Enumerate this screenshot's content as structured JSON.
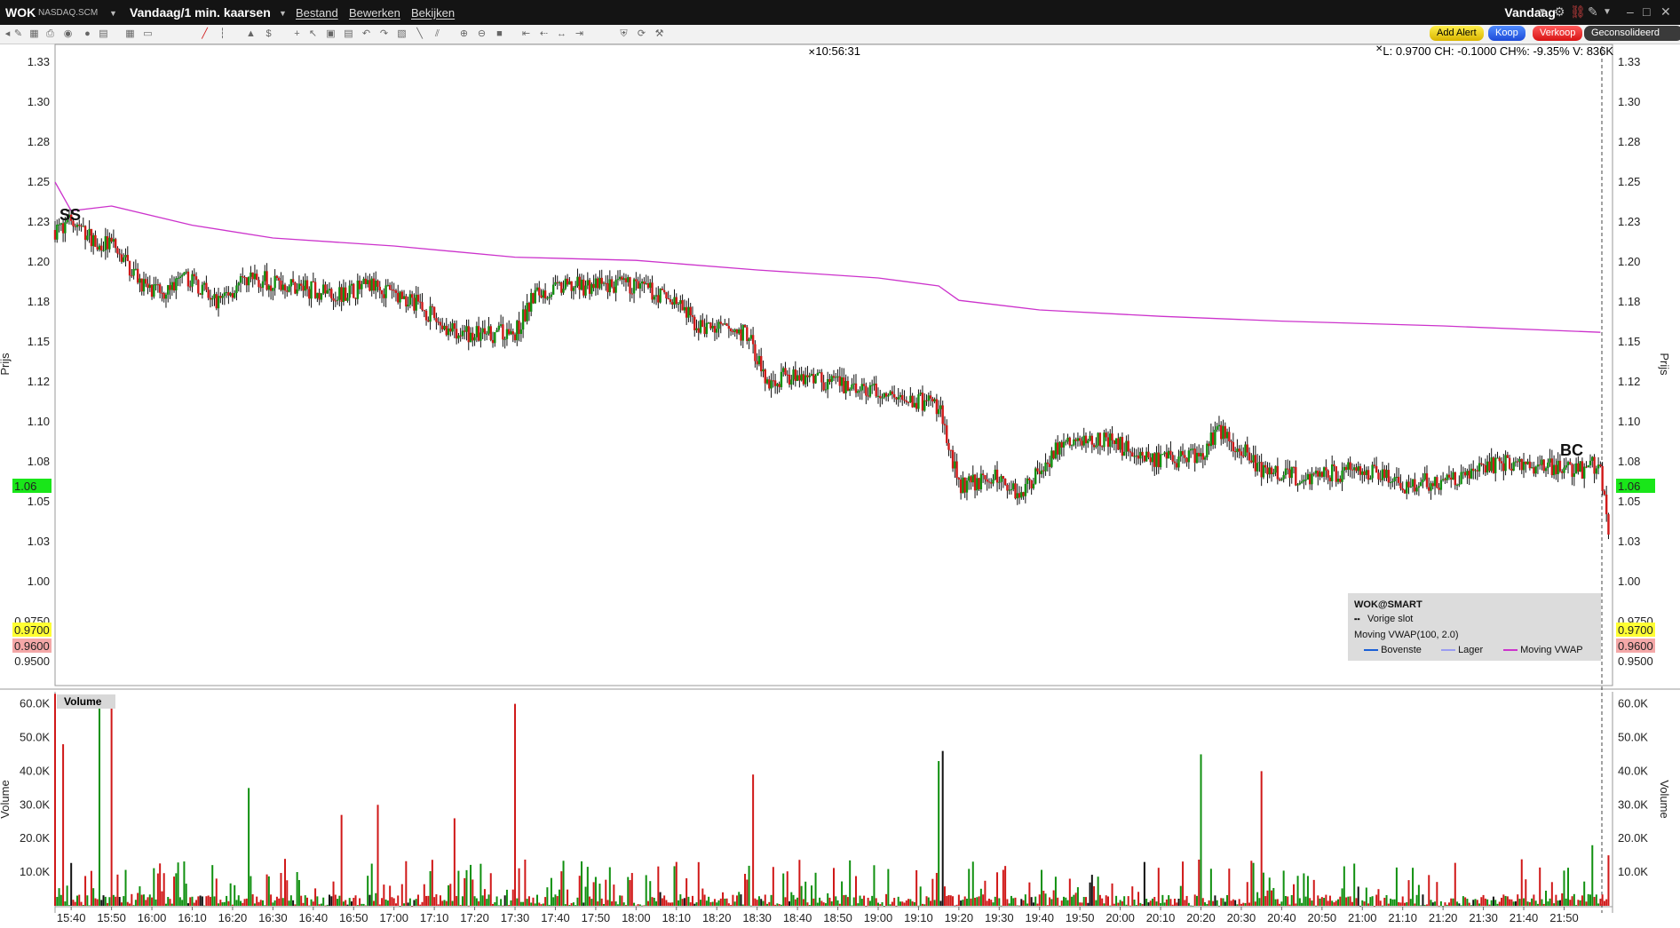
{
  "window": {
    "symbol": "WOK",
    "exchange": "NASDAQ.SCM",
    "period": "Vandaag/1 min. kaarsen",
    "menus": [
      "Bestand",
      "Bewerken",
      "Bekijken"
    ],
    "right_title": "Vandaag"
  },
  "toolbar": {
    "add_alert": "Add Alert",
    "buy": "Koop",
    "sell": "Verkoop",
    "consolidated": "Geconsolideerd"
  },
  "readout": {
    "crosshair_time": "10:56:31",
    "ohlc": "L: 0.9700 CH: -0.1000 CH%: -9.35% V: 836K"
  },
  "legend": {
    "title": "WOK@SMART",
    "prev_close": "Vorige slot",
    "indicator": "Moving VWAP(100, 2.0)",
    "upper": "Bovenste",
    "lower": "Lager",
    "vwap": "Moving VWAP"
  },
  "signals": {
    "ss": "SS",
    "bc": "BC"
  },
  "colors": {
    "up": "#109010",
    "down": "#d01818",
    "vwap": "#cc33cc",
    "bg": "#ffffff",
    "last_price_tag": "#19e619"
  },
  "chart_data": {
    "type": "candlestick",
    "title": "",
    "xlabel": "",
    "ylabel": "Prijs",
    "volume_label": "Volume",
    "volume_panel_tag": "Volume",
    "price_ticks": [
      "1.33",
      "1.30",
      "1.28",
      "1.25",
      "1.23",
      "1.20",
      "1.18",
      "1.15",
      "1.12",
      "1.10",
      "1.08",
      "1.05",
      "1.03",
      "1.00",
      "0.9750",
      "0.9500"
    ],
    "price_tick_values": [
      1.325,
      1.3,
      1.275,
      1.25,
      1.225,
      1.2,
      1.175,
      1.15,
      1.125,
      1.1,
      1.075,
      1.05,
      1.025,
      1.0,
      0.975,
      0.95
    ],
    "price_range": [
      0.935,
      1.335
    ],
    "volume_ticks": [
      "60.0K",
      "50.0K",
      "40.0K",
      "30.0K",
      "20.0K",
      "10.0K"
    ],
    "volume_tick_values": [
      60000,
      50000,
      40000,
      30000,
      20000,
      10000
    ],
    "volume_range": [
      0,
      62000
    ],
    "tags": [
      {
        "label": "1.06",
        "value": 1.06,
        "color": "#19e619"
      },
      {
        "label": "0.9700",
        "value": 0.97,
        "color": "#ffff33"
      },
      {
        "label": "0.9600",
        "value": 0.96,
        "color": "#f4a8a8"
      }
    ],
    "x_ticks": [
      "15:40",
      "15:50",
      "16:00",
      "16:10",
      "16:20",
      "16:30",
      "16:40",
      "16:50",
      "17:00",
      "17:10",
      "17:20",
      "17:30",
      "17:40",
      "17:50",
      "18:00",
      "18:10",
      "18:20",
      "18:30",
      "18:40",
      "18:50",
      "19:00",
      "19:10",
      "19:20",
      "19:30",
      "19:40",
      "19:50",
      "20:00",
      "20:10",
      "20:20",
      "20:30",
      "20:40",
      "20:50",
      "21:00",
      "21:10",
      "21:20",
      "21:30",
      "21:40",
      "21:50"
    ],
    "x_tick_minutes": [
      0,
      10,
      20,
      30,
      40,
      50,
      60,
      70,
      80,
      90,
      100,
      110,
      120,
      130,
      140,
      150,
      160,
      170,
      180,
      190,
      200,
      210,
      220,
      230,
      240,
      250,
      260,
      270,
      280,
      290,
      300,
      310,
      320,
      330,
      340,
      350,
      360,
      370
    ],
    "x_start": "15:36",
    "x_end": "22:02",
    "price_path": [
      {
        "t": "15:36",
        "p": 1.22
      },
      {
        "t": "15:40",
        "p": 1.225
      },
      {
        "t": "15:45",
        "p": 1.215
      },
      {
        "t": "15:50",
        "p": 1.21
      },
      {
        "t": "16:00",
        "p": 1.18
      },
      {
        "t": "16:10",
        "p": 1.19
      },
      {
        "t": "16:15",
        "p": 1.175
      },
      {
        "t": "16:25",
        "p": 1.19
      },
      {
        "t": "16:35",
        "p": 1.185
      },
      {
        "t": "16:45",
        "p": 1.18
      },
      {
        "t": "16:55",
        "p": 1.185
      },
      {
        "t": "17:05",
        "p": 1.175
      },
      {
        "t": "17:10",
        "p": 1.165
      },
      {
        "t": "17:15",
        "p": 1.155
      },
      {
        "t": "17:30",
        "p": 1.155
      },
      {
        "t": "17:35",
        "p": 1.18
      },
      {
        "t": "17:45",
        "p": 1.185
      },
      {
        "t": "18:00",
        "p": 1.185
      },
      {
        "t": "18:10",
        "p": 1.175
      },
      {
        "t": "18:15",
        "p": 1.16
      },
      {
        "t": "18:28",
        "p": 1.155
      },
      {
        "t": "18:32",
        "p": 1.125
      },
      {
        "t": "18:40",
        "p": 1.13
      },
      {
        "t": "18:55",
        "p": 1.12
      },
      {
        "t": "19:05",
        "p": 1.115
      },
      {
        "t": "19:15",
        "p": 1.11
      },
      {
        "t": "19:20",
        "p": 1.06
      },
      {
        "t": "19:30",
        "p": 1.065
      },
      {
        "t": "19:35",
        "p": 1.055
      },
      {
        "t": "19:45",
        "p": 1.085
      },
      {
        "t": "19:55",
        "p": 1.09
      },
      {
        "t": "20:10",
        "p": 1.075
      },
      {
        "t": "20:20",
        "p": 1.08
      },
      {
        "t": "20:25",
        "p": 1.095
      },
      {
        "t": "20:35",
        "p": 1.07
      },
      {
        "t": "20:45",
        "p": 1.065
      },
      {
        "t": "21:00",
        "p": 1.07
      },
      {
        "t": "21:10",
        "p": 1.06
      },
      {
        "t": "21:25",
        "p": 1.065
      },
      {
        "t": "21:35",
        "p": 1.075
      },
      {
        "t": "21:55",
        "p": 1.07
      },
      {
        "t": "21:59",
        "p": 1.075
      },
      {
        "t": "22:00",
        "p": 1.05
      },
      {
        "t": "22:01",
        "p": 1.03
      }
    ],
    "vwap": [
      {
        "t": "15:36",
        "p": 1.25
      },
      {
        "t": "15:40",
        "p": 1.232
      },
      {
        "t": "15:50",
        "p": 1.235
      },
      {
        "t": "16:10",
        "p": 1.223
      },
      {
        "t": "16:30",
        "p": 1.215
      },
      {
        "t": "17:00",
        "p": 1.21
      },
      {
        "t": "17:30",
        "p": 1.203
      },
      {
        "t": "18:00",
        "p": 1.201
      },
      {
        "t": "18:30",
        "p": 1.195
      },
      {
        "t": "19:00",
        "p": 1.19
      },
      {
        "t": "19:15",
        "p": 1.185
      },
      {
        "t": "19:20",
        "p": 1.176
      },
      {
        "t": "19:40",
        "p": 1.17
      },
      {
        "t": "20:10",
        "p": 1.166
      },
      {
        "t": "20:40",
        "p": 1.163
      },
      {
        "t": "21:20",
        "p": 1.16
      },
      {
        "t": "21:59",
        "p": 1.156
      }
    ],
    "volume_highlights": [
      {
        "t": "15:36",
        "v": 63000
      },
      {
        "t": "15:38",
        "v": 48000
      },
      {
        "t": "15:47",
        "v": 62000
      },
      {
        "t": "15:50",
        "v": 60000
      },
      {
        "t": "16:24",
        "v": 35000
      },
      {
        "t": "16:47",
        "v": 27000
      },
      {
        "t": "16:56",
        "v": 30000
      },
      {
        "t": "17:15",
        "v": 26000
      },
      {
        "t": "17:30",
        "v": 60000
      },
      {
        "t": "18:29",
        "v": 39000
      },
      {
        "t": "19:15",
        "v": 43000
      },
      {
        "t": "19:16",
        "v": 46000
      },
      {
        "t": "20:20",
        "v": 45000
      },
      {
        "t": "20:35",
        "v": 40000
      },
      {
        "t": "21:57",
        "v": 18000
      },
      {
        "t": "22:01",
        "v": 15000
      }
    ]
  }
}
